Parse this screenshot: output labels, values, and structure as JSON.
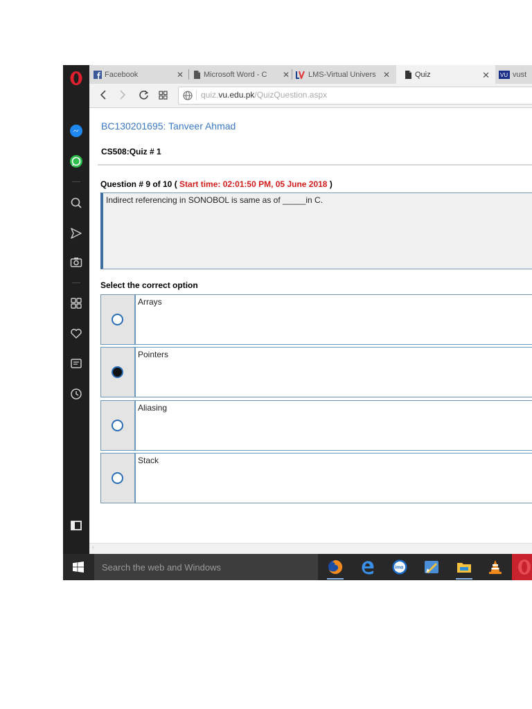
{
  "browser": {
    "tabs": [
      {
        "label": "Facebook",
        "icon": "facebook-icon",
        "active": false
      },
      {
        "label": "Microsoft Word - C",
        "icon": "document-icon",
        "active": false
      },
      {
        "label": "LMS-Virtual Univers",
        "icon": "lms-icon",
        "active": false
      },
      {
        "label": "Quiz",
        "icon": "document-icon",
        "active": true
      },
      {
        "label": "vust",
        "icon": "vu-logo-icon",
        "active": false
      }
    ],
    "url_prefix": "quiz.",
    "url_domain": "vu.edu.pk",
    "url_path": "/QuizQuestion.aspx"
  },
  "quiz": {
    "student": "BC130201695: Tanveer Ahmad",
    "title": "CS508:Quiz # 1",
    "question_label": "Question # 9 of 10 (",
    "start_time": "Start time: 02:01:50 PM, 05 June 2018",
    "question_close": ")",
    "question_text": "Indirect referencing in SONOBOL is same as of _____in C.",
    "select_heading": "Select the correct option",
    "options": [
      {
        "label": "Arrays",
        "selected": false
      },
      {
        "label": "Pointers",
        "selected": true
      },
      {
        "label": "Aliasing",
        "selected": false
      },
      {
        "label": "Stack",
        "selected": false
      }
    ]
  },
  "taskbar": {
    "search_placeholder": "Search the web and Windows"
  },
  "colors": {
    "student_name": "#3a79c4",
    "start_time": "#d21c1c",
    "option_border": "#6d98bc",
    "opera_red": "#c8232c"
  }
}
